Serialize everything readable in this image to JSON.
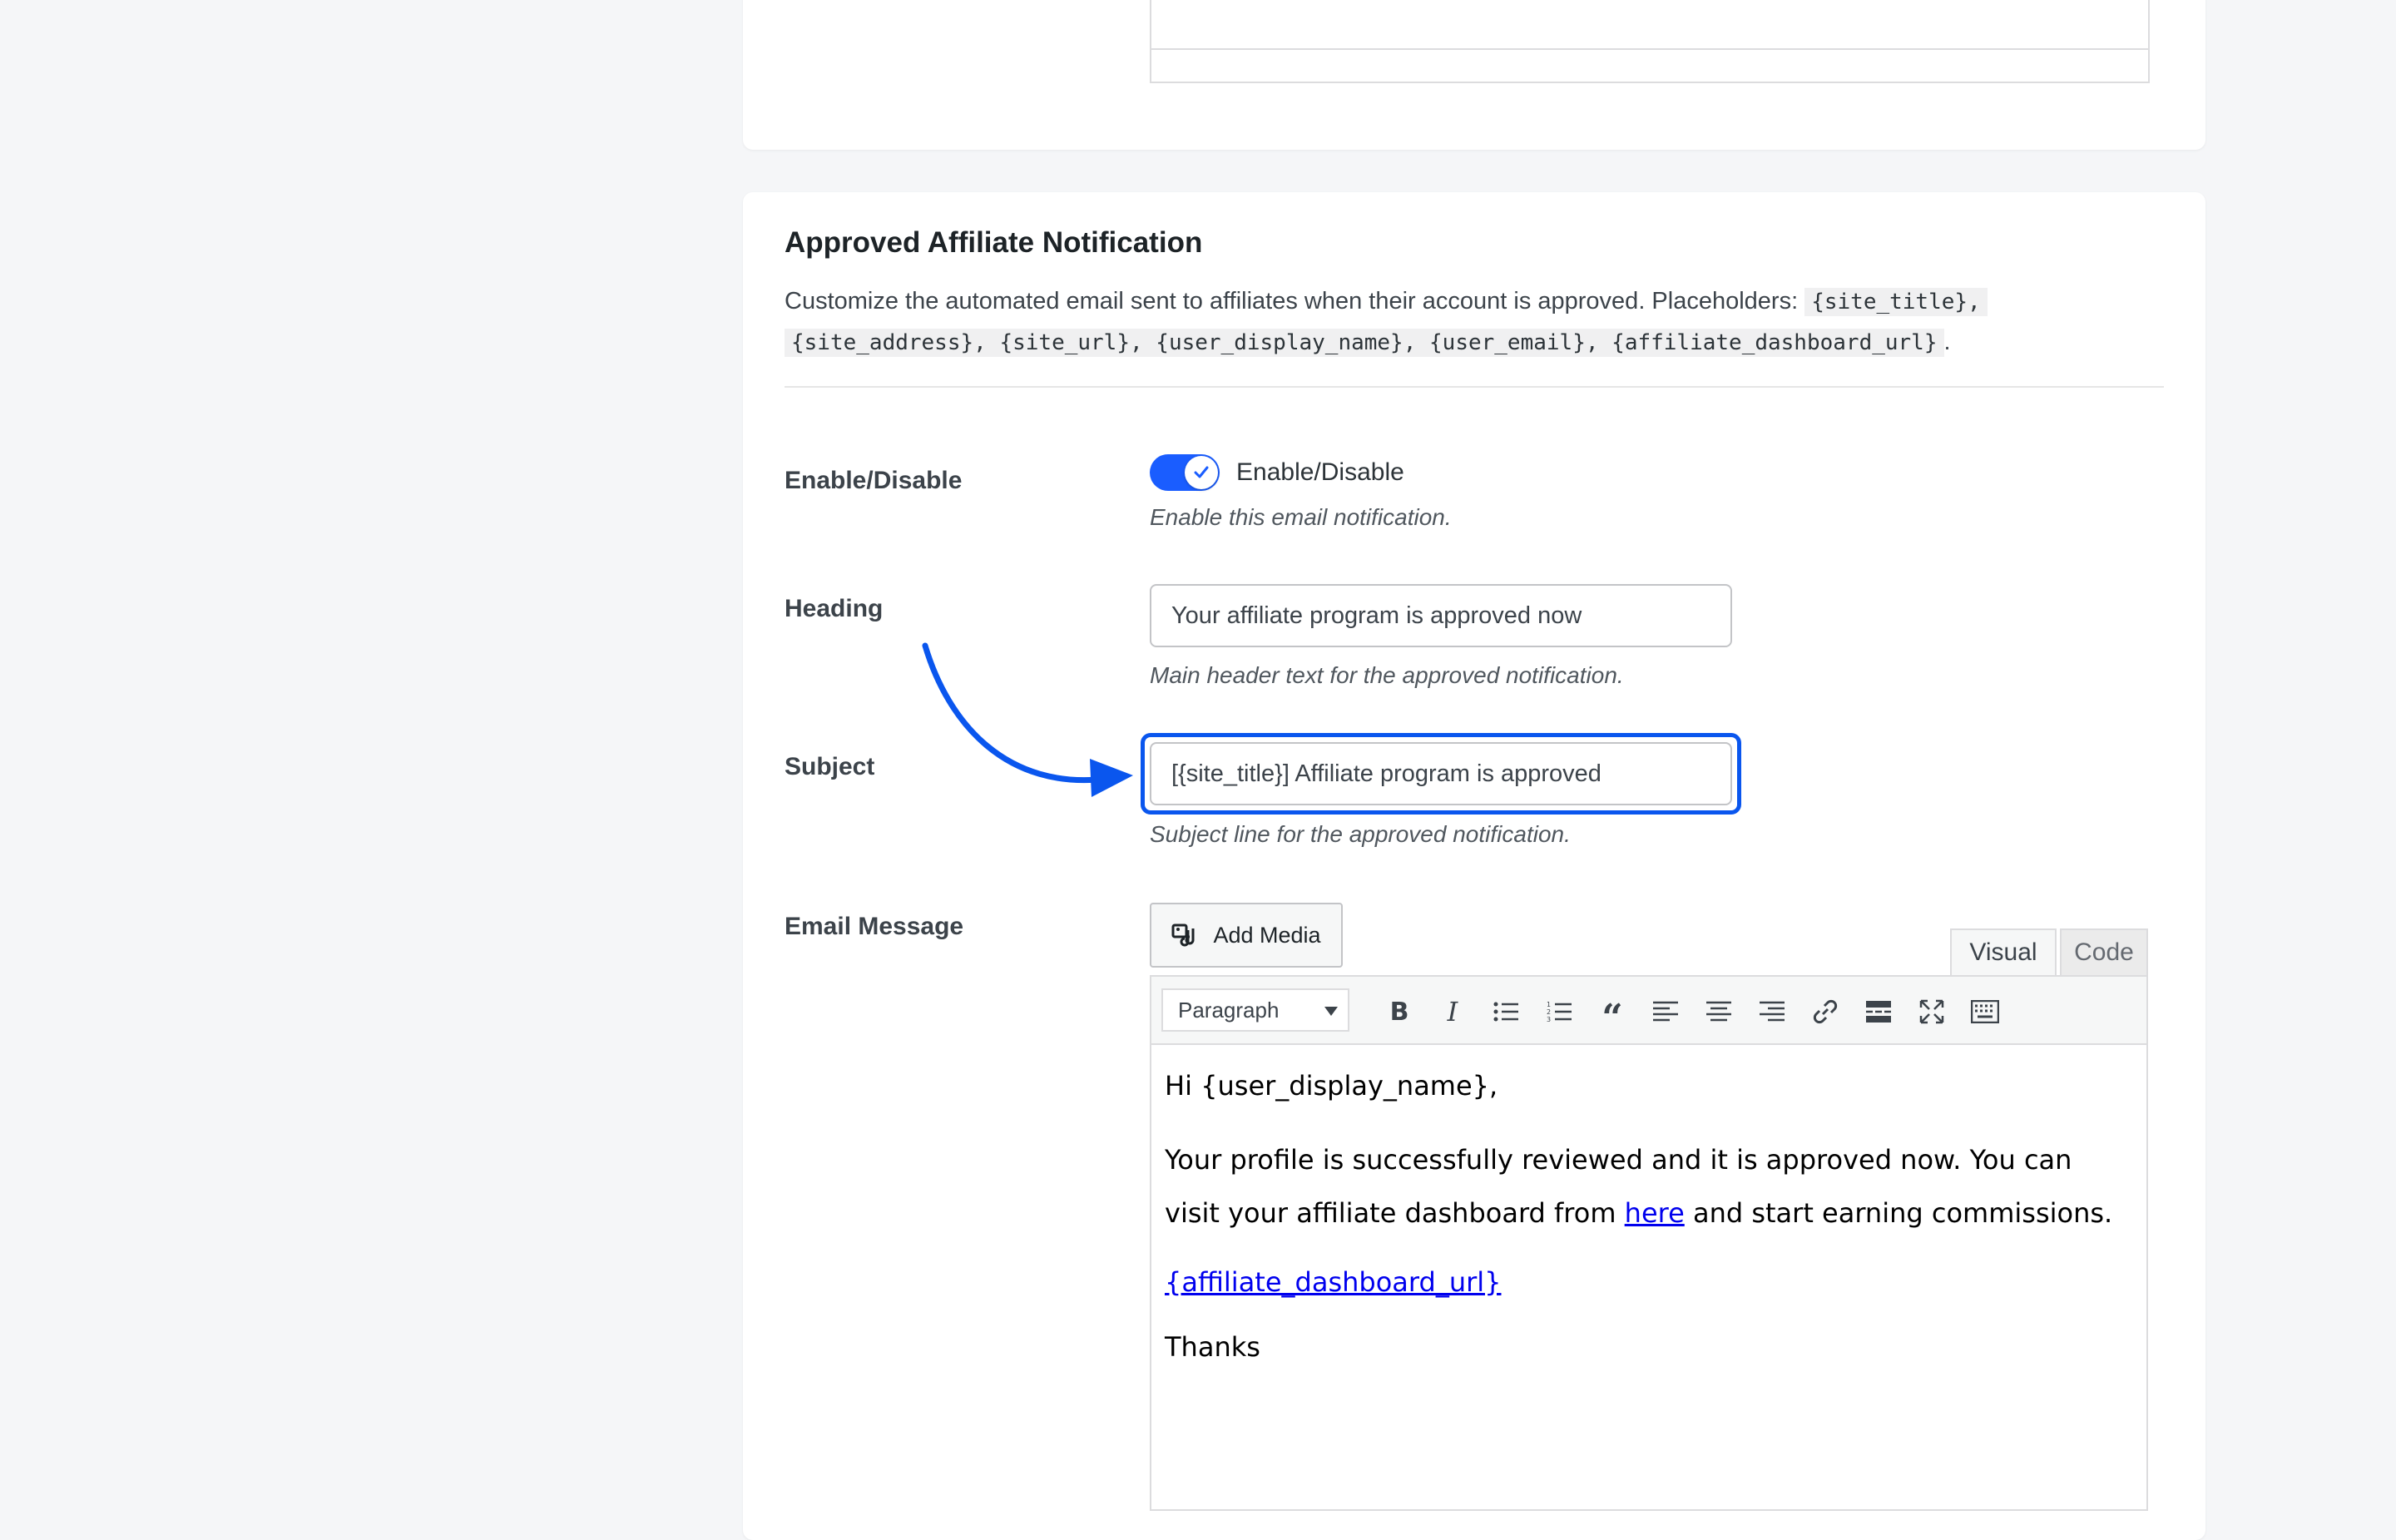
{
  "section": {
    "title": "Approved Affiliate Notification",
    "description_prefix": "Customize the automated email sent to affiliates when their account is approved. Placeholders: ",
    "placeholders": [
      "{site_title},",
      "{site_address}, {site_url}, {user_display_name}, {user_email}, {affiliate_dashboard_url}"
    ],
    "description_suffix": "."
  },
  "fields": {
    "enable": {
      "label": "Enable/Disable",
      "toggle_text": "Enable/Disable",
      "help": "Enable this email notification.",
      "checked": true
    },
    "heading": {
      "label": "Heading",
      "value": "Your affiliate program is approved now",
      "help": "Main header text for the approved notification."
    },
    "subject": {
      "label": "Subject",
      "value": "[{site_title}] Affiliate program is approved",
      "help": "Subject line for the approved notification."
    },
    "email_message": {
      "label": "Email Message"
    }
  },
  "editor": {
    "add_media_label": "Add Media",
    "tabs": {
      "visual": "Visual",
      "code": "Code"
    },
    "format_select": "Paragraph",
    "toolbar_icons": [
      "bold-icon",
      "italic-icon",
      "bullet-list-icon",
      "numbered-list-icon",
      "blockquote-icon",
      "align-left-icon",
      "align-center-icon",
      "align-right-icon",
      "link-icon",
      "read-more-icon",
      "fullscreen-icon",
      "toolbar-toggle-icon"
    ],
    "content": {
      "greeting": "Hi {user_display_name},",
      "para_before_link": "Your profile is successfully reviewed and it is approved now. You can visit your affiliate dashboard from ",
      "link_text": "here",
      "para_after_link": " and start earning commissions.",
      "dashboard_link": "{affiliate_dashboard_url}",
      "closing": "Thanks"
    }
  },
  "colors": {
    "accent": "#1a5dff",
    "highlight": "#0a56ee",
    "link": "#0000ee"
  }
}
